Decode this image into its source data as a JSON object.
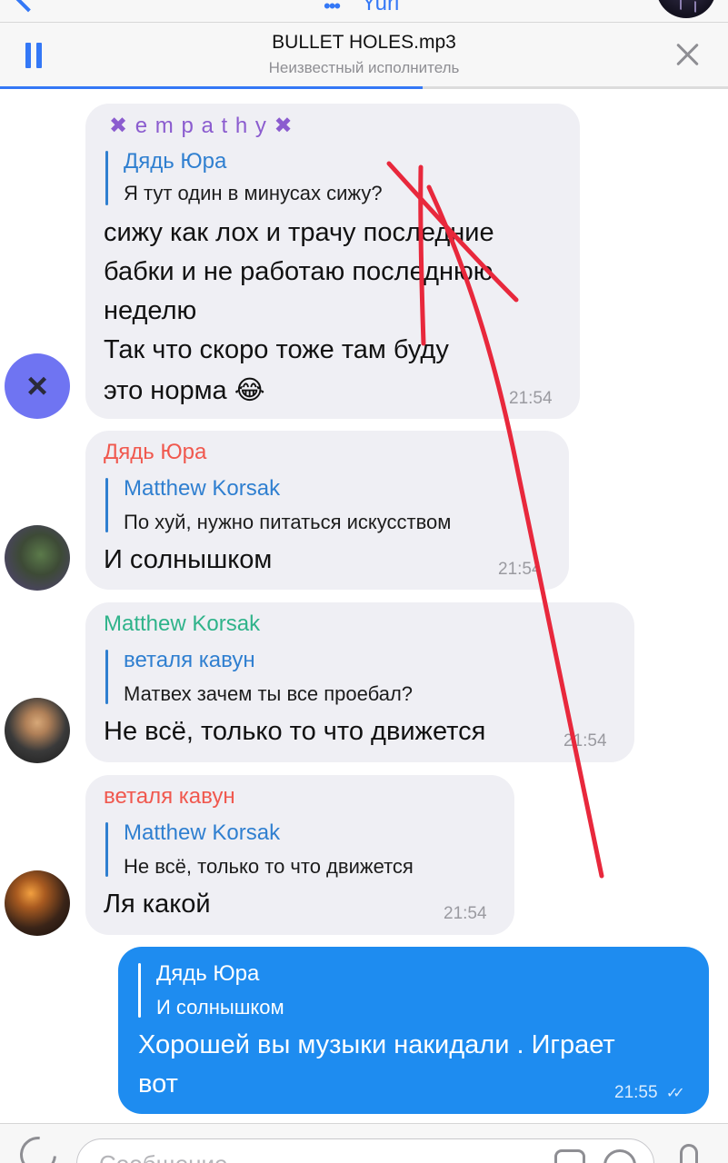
{
  "header": {
    "title": "Yuri",
    "typing_indicator": "•••"
  },
  "player": {
    "track_title": "BULLET HOLES.mp3",
    "artist": "Неизвестный исполнитель",
    "progress": 0.58
  },
  "messages": [
    {
      "sender": "✖ e m p a t h y ✖",
      "sender_color": "#8b5ccf",
      "reply_name": "Дядь Юра",
      "reply_text": "Я тут один в минусах сижу?",
      "lines": [
        "сижу как лох и трачу последние",
        "бабки и не работаю последнюю",
        "неделю",
        "Так что скоро тоже там буду",
        "это норма 😂"
      ],
      "time": "21:54",
      "avatar_icon": "×"
    },
    {
      "sender": "Дядь Юра",
      "sender_color": "#f0584e",
      "reply_name": "Matthew Korsak",
      "reply_text": "По хуй, нужно питаться искусством",
      "lines": [
        "И солнышком"
      ],
      "time": "21:54"
    },
    {
      "sender": "Matthew Korsak",
      "sender_color": "#2fb38a",
      "reply_name": "веталя кавун",
      "reply_text": "Матвех зачем ты все проебал?",
      "lines": [
        "Не всё, только то что движется"
      ],
      "time": "21:54"
    },
    {
      "sender": "веталя кавун",
      "sender_color": "#f0584e",
      "reply_name": "Matthew Korsak",
      "reply_text": "Не всё, только то что движется",
      "lines": [
        "Ля какой"
      ],
      "time": "21:54"
    },
    {
      "outgoing": true,
      "reply_name": "Дядь Юра",
      "reply_text": "И солнышком",
      "lines": [
        "Хорошей вы музыки накидали . Играет",
        "вот"
      ],
      "time": "21:55",
      "status_icon": "✓✓"
    }
  ],
  "input": {
    "placeholder": "Сообщение"
  },
  "colors": {
    "accent": "#3478f6",
    "incoming_bubble": "#efeff4",
    "outgoing_bubble": "#1e8cf0",
    "annotation_stroke": "#e8283c"
  },
  "icons": [
    "back-chevron-icon",
    "pause-icon",
    "close-icon",
    "attach-icon",
    "sticker-icon",
    "clock-icon",
    "microphone-icon",
    "read-checkmarks-icon"
  ]
}
